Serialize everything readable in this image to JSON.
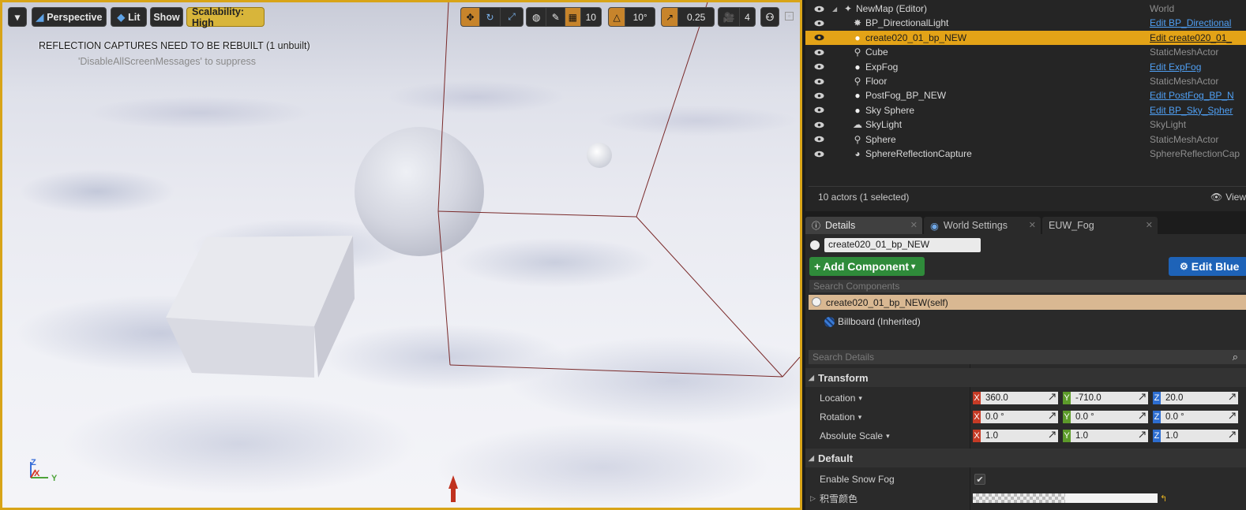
{
  "viewport": {
    "toolbar": {
      "perspective_label": "Perspective",
      "lit_label": "Lit",
      "show_label": "Show",
      "scalability_label": "Scalability: High",
      "grid_snap_value": "10",
      "rotation_snap_value": "10°",
      "scale_snap_value": "0.25",
      "camera_speed_value": "4"
    },
    "messages": {
      "line1": "REFLECTION CAPTURES NEED TO BE REBUILT (1 unbuilt)",
      "line2": "'DisableAllScreenMessages' to suppress"
    },
    "axis": {
      "z": "Z",
      "x": "X",
      "y": "Y"
    }
  },
  "outliner": {
    "rows": [
      {
        "label": "NewMap (Editor)",
        "type": "World",
        "type_is_link": false,
        "icon": "world-icon"
      },
      {
        "label": "BP_DirectionalLight",
        "type": "Edit BP_Directional",
        "type_is_link": true,
        "icon": "directional-light-icon"
      },
      {
        "label": "create020_01_bp_NEW",
        "type": "Edit create020_01_",
        "type_is_link": true,
        "icon": "sphere-icon",
        "selected": true
      },
      {
        "label": "Cube",
        "type": "StaticMeshActor",
        "type_is_link": false,
        "icon": "static-mesh-icon"
      },
      {
        "label": "ExpFog",
        "type": "Edit ExpFog",
        "type_is_link": true,
        "icon": "sphere-icon"
      },
      {
        "label": "Floor",
        "type": "StaticMeshActor",
        "type_is_link": false,
        "icon": "static-mesh-icon"
      },
      {
        "label": "PostFog_BP_NEW",
        "type": "Edit PostFog_BP_N",
        "type_is_link": true,
        "icon": "sphere-icon"
      },
      {
        "label": "Sky Sphere",
        "type": "Edit BP_Sky_Spher",
        "type_is_link": true,
        "icon": "sphere-icon"
      },
      {
        "label": "SkyLight",
        "type": "SkyLight",
        "type_is_link": false,
        "icon": "sky-light-icon"
      },
      {
        "label": "Sphere",
        "type": "StaticMeshActor",
        "type_is_link": false,
        "icon": "static-mesh-icon"
      },
      {
        "label": "SphereReflectionCapture",
        "type": "SphereReflectionCap",
        "type_is_link": false,
        "icon": "reflection-capture-icon"
      }
    ],
    "status": "10 actors (1 selected)",
    "view_label": "View"
  },
  "tabs": [
    {
      "label": "Details",
      "active": true
    },
    {
      "label": "World Settings",
      "active": false
    },
    {
      "label": "EUW_Fog",
      "active": false
    }
  ],
  "details": {
    "actor_name": "create020_01_bp_NEW",
    "add_component_label": "Add Component",
    "edit_blueprint_label": "Edit Blue",
    "search_components_placeholder": "Search Components",
    "self_component": "create020_01_bp_NEW(self)",
    "billboard_component": "Billboard (Inherited)",
    "search_details_placeholder": "Search Details",
    "transform": {
      "category": "Transform",
      "location": {
        "label": "Location",
        "x": "360.0",
        "y": "-710.0",
        "z": "20.0"
      },
      "rotation": {
        "label": "Rotation",
        "x": "0.0 °",
        "y": "0.0 °",
        "z": "0.0 °"
      },
      "scale": {
        "label": "Absolute Scale",
        "x": "1.0",
        "y": "1.0",
        "z": "1.0"
      }
    },
    "default": {
      "category": "Default",
      "enable_snow_fog_label": "Enable Snow Fog",
      "enable_snow_fog_checked": true,
      "snow_color_label": "积雪颜色"
    }
  },
  "colors": {
    "selection": "#e3a317",
    "viewport_border": "#d8a418",
    "add_component": "#2f8b3a",
    "edit_blueprint": "#1e63b8",
    "link": "#4f9ff3"
  }
}
